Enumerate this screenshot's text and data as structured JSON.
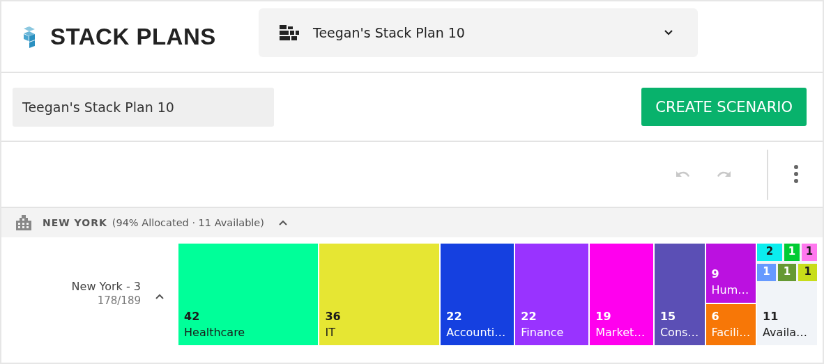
{
  "app": {
    "title": "STACK PLANS"
  },
  "plan_selector": {
    "value": "Teegan's Stack Plan 10"
  },
  "plan_name_field": {
    "value": "Teegan's Stack Plan 10"
  },
  "create_button": {
    "label": "CREATE SCENARIO"
  },
  "toolbar": {
    "undo": {
      "disabled": true
    },
    "redo": {
      "disabled": true
    }
  },
  "building": {
    "name": "NEW YORK",
    "summary": "(94% Allocated · 11 Available)",
    "expanded": true,
    "floors": [
      {
        "name": "New York - 3",
        "usage": "178/189",
        "expanded": true,
        "columns": [
          {
            "kind": "single",
            "tiles": [
              {
                "count": "42",
                "label": "Healthcare",
                "color": "#00ff99"
              }
            ]
          },
          {
            "kind": "single",
            "tiles": [
              {
                "count": "36",
                "label": "IT",
                "color": "#e6e633"
              }
            ]
          },
          {
            "kind": "single",
            "tiles": [
              {
                "count": "22",
                "label": "Accounti…",
                "color": "#1540e0"
              }
            ]
          },
          {
            "kind": "single",
            "tiles": [
              {
                "count": "22",
                "label": "Finance",
                "color": "#9933ff"
              }
            ]
          },
          {
            "kind": "single",
            "tiles": [
              {
                "count": "19",
                "label": "Market…",
                "color": "#ff00ee"
              }
            ]
          },
          {
            "kind": "single",
            "tiles": [
              {
                "count": "15",
                "label": "Cons…",
                "color": "#5b4fb5"
              }
            ]
          },
          {
            "kind": "stack",
            "tiles": [
              {
                "count": "9",
                "label": "Hum…",
                "color": "#bb11e0"
              },
              {
                "count": "6",
                "label": "Facili…",
                "color": "#f77707"
              }
            ]
          },
          {
            "kind": "mixed",
            "rows": [
              [
                {
                  "count": "2",
                  "color": "#0bedee"
                },
                {
                  "count": "1",
                  "color": "#00cc33"
                },
                {
                  "count": "1",
                  "color": "#ff77ee"
                }
              ],
              [
                {
                  "count": "1",
                  "color": "#6699ff"
                },
                {
                  "count": "1",
                  "color": "#669933"
                },
                {
                  "count": "1",
                  "color": "#c8dd1a"
                }
              ]
            ],
            "available": {
              "count": "11",
              "label": "Availa…"
            }
          }
        ]
      }
    ]
  }
}
